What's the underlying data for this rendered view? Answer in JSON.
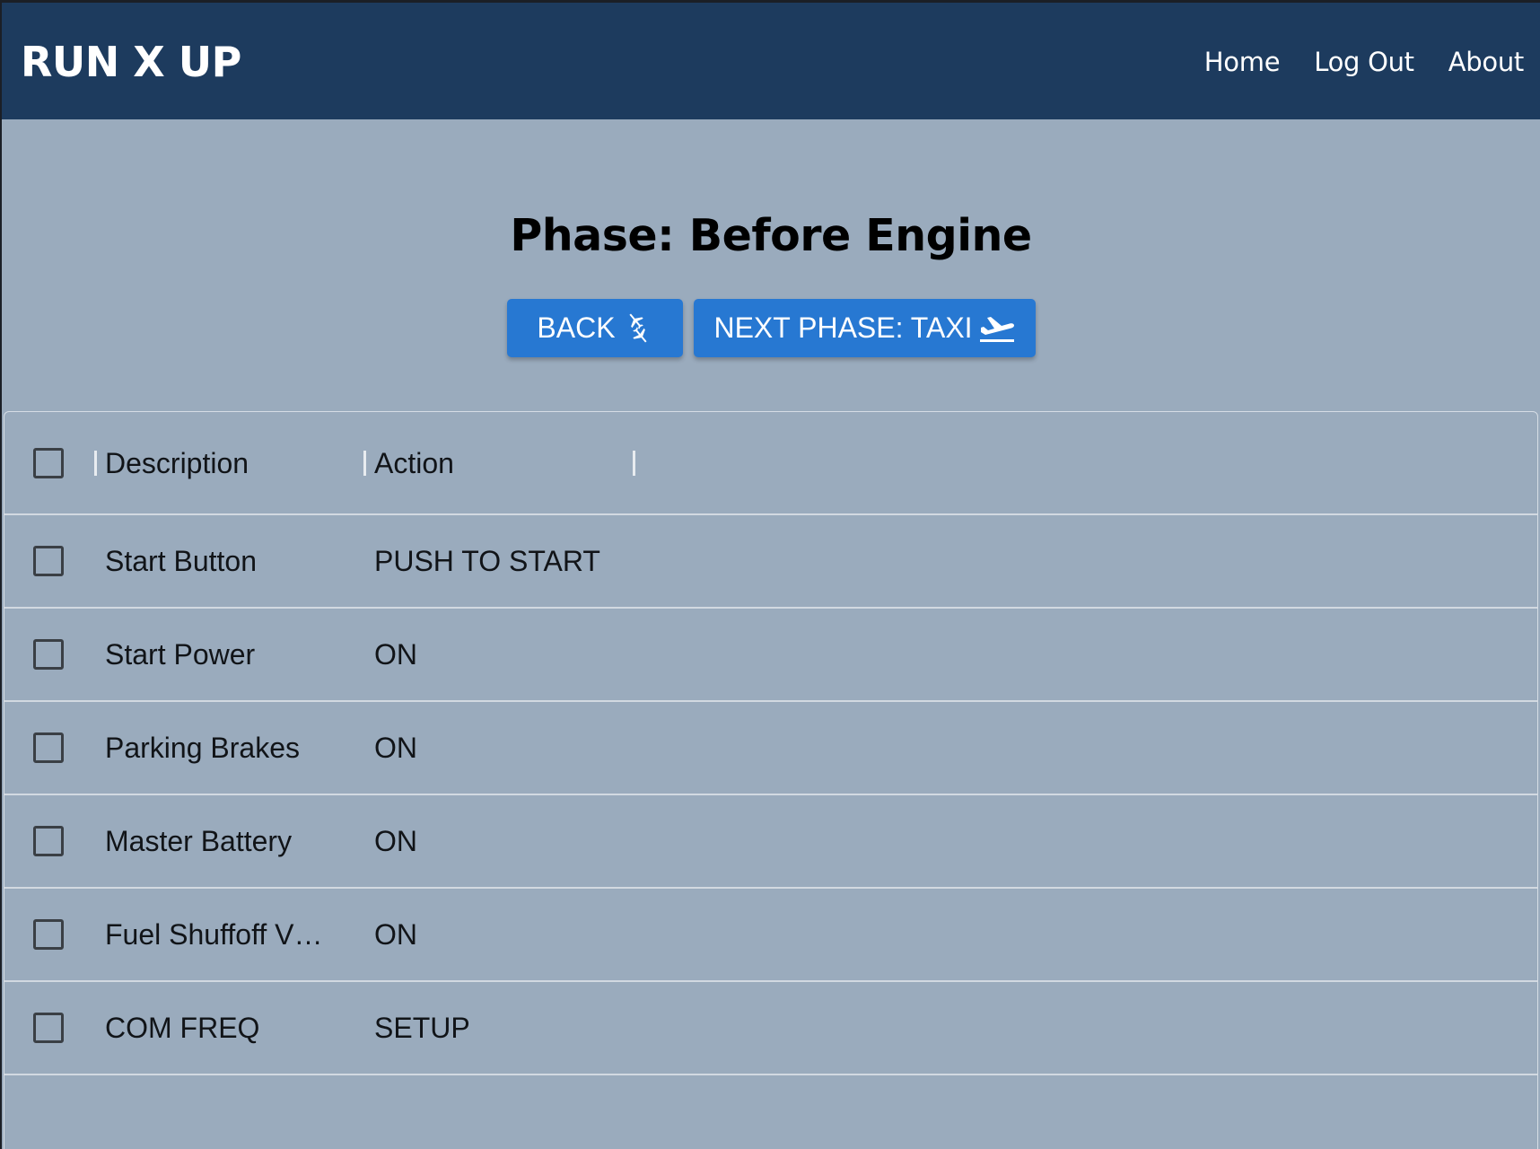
{
  "navbar": {
    "brand": "RUN X UP",
    "links": [
      "Home",
      "Log Out",
      "About"
    ]
  },
  "phase": {
    "title": "Phase: Before Engine",
    "back_label": "BACK",
    "next_label": "NEXT PHASE: TAXI"
  },
  "table": {
    "columns": [
      "Description",
      "Action"
    ],
    "rows": [
      {
        "description": "Start Button",
        "action": "PUSH TO START",
        "checked": false
      },
      {
        "description": "Start Power",
        "action": "ON",
        "checked": false
      },
      {
        "description": "Parking Brakes",
        "action": "ON",
        "checked": false
      },
      {
        "description": "Master Battery",
        "action": "ON",
        "checked": false
      },
      {
        "description": "Fuel Shuffoff V…",
        "action": "ON",
        "checked": false
      },
      {
        "description": "COM FREQ",
        "action": "SETUP",
        "checked": false
      }
    ]
  },
  "icons": {
    "back": "connecting-airports-icon",
    "next": "flight-takeoff-icon"
  },
  "colors": {
    "navbar": "#1d3b5e",
    "background": "#9aabbd",
    "button": "#2778d2"
  }
}
